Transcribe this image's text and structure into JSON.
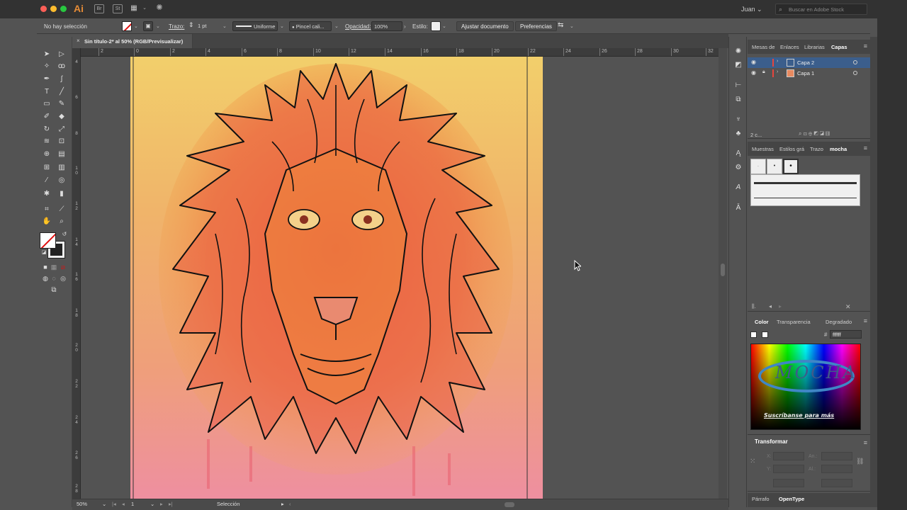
{
  "app": {
    "logo": "Ai",
    "user": "Juan",
    "search_placeholder": "Buscar en Adobe Stock",
    "bridge_label": "Br",
    "stock_label": "St"
  },
  "controlbar": {
    "selection_status": "No hay selección",
    "stroke_label": "Trazo:",
    "stroke_weight": "1 pt",
    "profile": "Uniforme",
    "brush": "Pincel cali...",
    "opacity_label": "Opacidad:",
    "opacity_value": "100%",
    "style_label": "Estilo:",
    "fit_document_button": "Ajustar documento",
    "preferences_button": "Preferencias"
  },
  "document": {
    "tab_title": "Sin título-2* al 50% (RGB/Previsualizar)",
    "close_glyph": "×",
    "h_ruler_ticks": [
      "2",
      "0",
      "2",
      "4",
      "6",
      "8",
      "10",
      "12",
      "14",
      "16",
      "18",
      "20",
      "22",
      "24",
      "26",
      "28",
      "30",
      "32"
    ],
    "v_ruler_ticks": [
      "4",
      "6",
      "8",
      "1\n0",
      "1\n2",
      "1\n4",
      "1\n6",
      "1\n8",
      "2\n0",
      "2\n2",
      "2\n4",
      "2\n6",
      "2\n8"
    ]
  },
  "statusbar": {
    "zoom": "50%",
    "artboard_number": "1",
    "tool_name": "Selección"
  },
  "panels": {
    "layers": {
      "tabs": [
        "Mesas de",
        "Enlaces",
        "Librarias",
        "Capas"
      ],
      "active_tab": "Capas",
      "layers": [
        {
          "name": "Capa 2",
          "color": "#e8453c",
          "locked": false
        },
        {
          "name": "Capa 1",
          "color": "#e8453c",
          "locked": true
        }
      ],
      "count_label": "2 c..."
    },
    "brushes": {
      "tabs": [
        "Muestras",
        "Estilos grá",
        "Trazo",
        "mocha"
      ],
      "active_tab": "mocha"
    },
    "color": {
      "tabs": [
        "Color",
        "Transparencia",
        "Degradado"
      ],
      "active_tab": "Color",
      "hex_label": "#",
      "hex_value": "ffffff",
      "watermark_text": "MOCHA",
      "watermark_subtitle": "Suscríbanse para más"
    },
    "transform": {
      "title": "Transformar",
      "x_label": "X:",
      "y_label": "Y:",
      "w_label": "An.:",
      "h_label": "Al.:"
    },
    "bottom_tabs": [
      "Párrafo",
      "OpenType"
    ],
    "bottom_active_tab": "OpenType"
  },
  "colors": {
    "accent": "#e58b36",
    "layer_highlight": "#3b5e8c",
    "ui_bg": "#535353",
    "canvas_bg": "#535353"
  }
}
